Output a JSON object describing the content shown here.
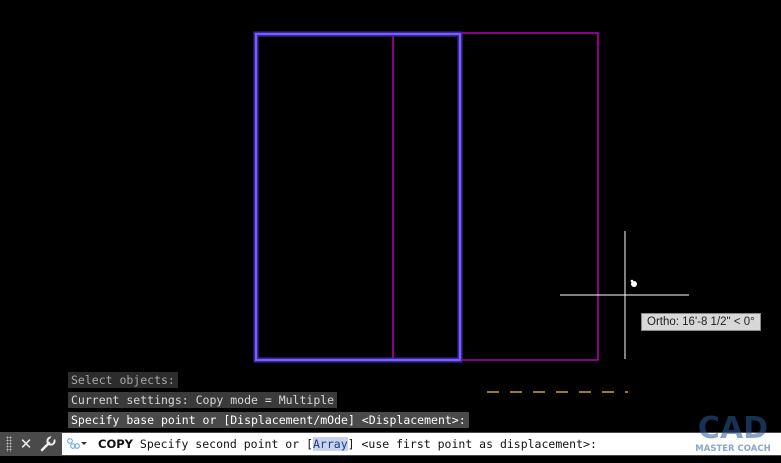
{
  "command_history": [
    "Select objects:",
    "Current settings:  Copy mode = Multiple",
    "Specify base point or [Displacement/mOde] <Displacement>:"
  ],
  "tooltip": {
    "ortho": "Ortho: 16'-8 1/2\" < 0°"
  },
  "command_line": {
    "command": "COPY",
    "prompt_before": " Specify second point or [",
    "option": "Array",
    "prompt_after": "] <use first point as displacement>:"
  },
  "watermark": {
    "text_main": "CAD",
    "text_sub": "MASTER COACH"
  },
  "colors": {
    "background": "#000000",
    "selected_rect": "#6a4cff",
    "copy_rect": "#d400d4",
    "crosshair": "#ffffff",
    "ortho_track": "#d9a220"
  },
  "icons": [
    "grip-icon",
    "close-icon",
    "wrench-icon",
    "command-icon",
    "cursor-pickbox-icon"
  ]
}
